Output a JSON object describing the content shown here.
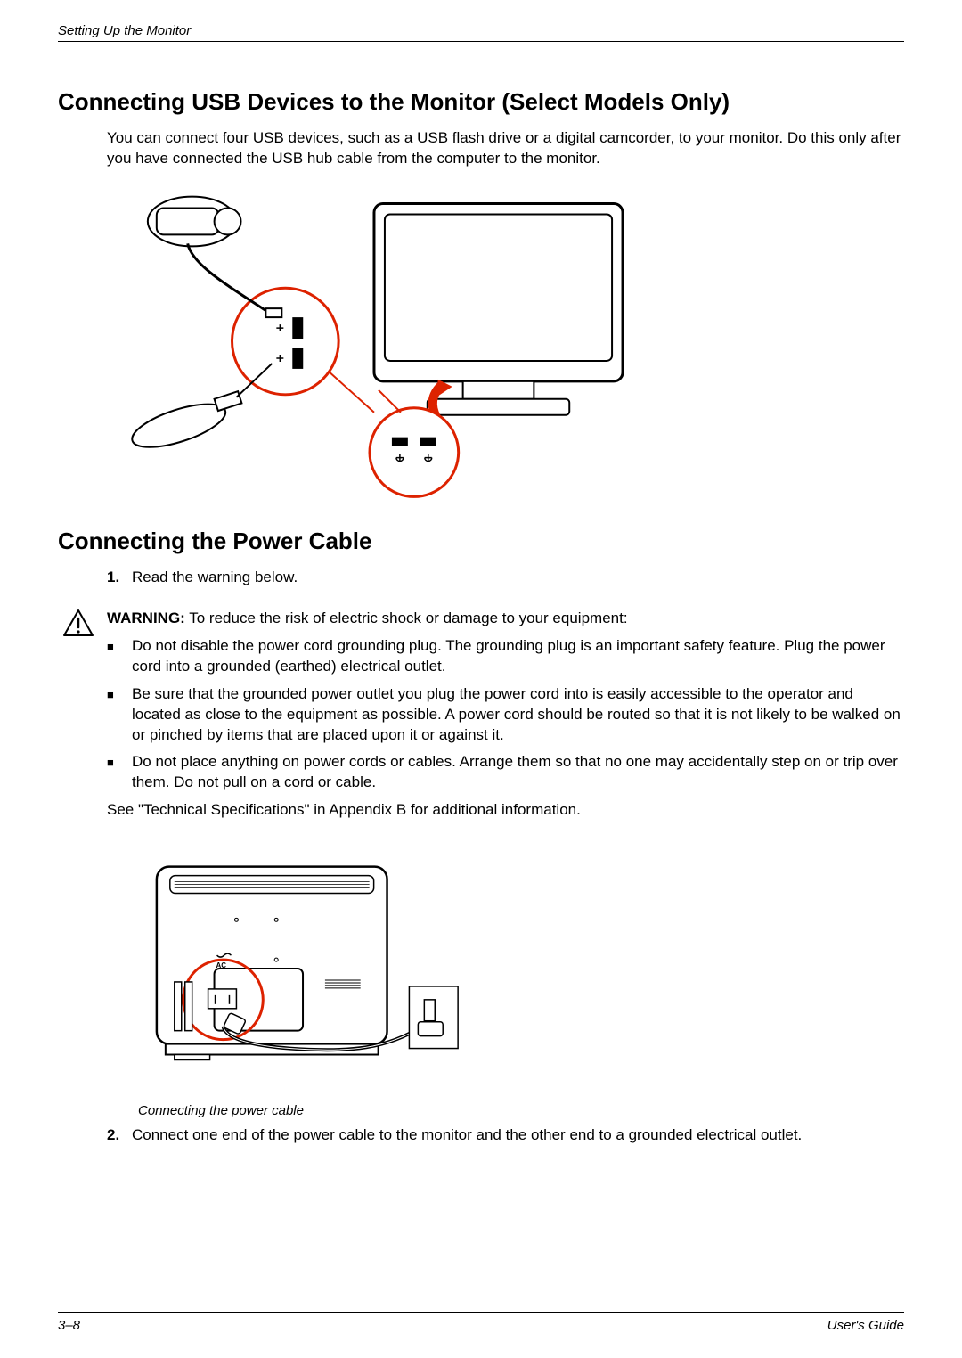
{
  "header": {
    "section": "Setting Up the Monitor"
  },
  "section1": {
    "heading": "Connecting USB Devices to the Monitor (Select Models Only)",
    "paragraph": "You can connect four USB devices, such as a USB flash drive or a digital camcorder, to your monitor. Do this only after you have connected the USB hub cable from the computer to the monitor."
  },
  "section2": {
    "heading": "Connecting the Power Cable",
    "step1_num": "1.",
    "step1_text": "Read the warning below.",
    "warning_label": "WARNING:",
    "warning_intro": " To reduce the risk of electric shock or damage to your equipment:",
    "bullets": [
      "Do not disable the power cord grounding plug. The grounding plug is an important safety feature. Plug the power cord into a grounded (earthed) electrical outlet.",
      "Be sure that the grounded power outlet you plug the power cord into is easily accessible to the operator and located as close to the equipment as possible. A power cord should be routed so that it is not likely to be walked on or pinched by items that are placed upon it or against it.",
      "Do not place anything on power cords or cables. Arrange them so that no one may accidentally step on or trip over them. Do not pull on a cord or cable."
    ],
    "warning_footer": "See \"Technical Specifications\" in Appendix B for additional information.",
    "caption": "Connecting the power cable",
    "step2_num": "2.",
    "step2_text": "Connect one end of the power cable to the monitor and the other end to a grounded electrical outlet."
  },
  "footer": {
    "page": "3–8",
    "doc": "User's Guide"
  }
}
